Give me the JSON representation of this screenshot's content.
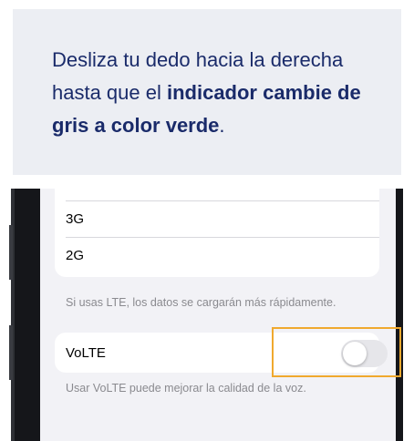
{
  "instruction": {
    "text_before": "Desliza tu dedo hacia la derecha hasta que el ",
    "bold_1": "indicador cambie de gris a color verde",
    "text_after": "."
  },
  "settings": {
    "network_options": [
      "3G",
      "2G"
    ],
    "lte_footer": "Si usas LTE, los datos se cargarán más rápidamente.",
    "volte_label": "VoLTE",
    "volte_toggle_state": "off",
    "volte_footer": "Usar VoLTE puede mejorar la calidad de la voz."
  },
  "colors": {
    "instruction_bg": "#eceef3",
    "instruction_text": "#1a2b6a",
    "highlight": "#f0a92e",
    "toggle_off": "#e6e6ea"
  }
}
